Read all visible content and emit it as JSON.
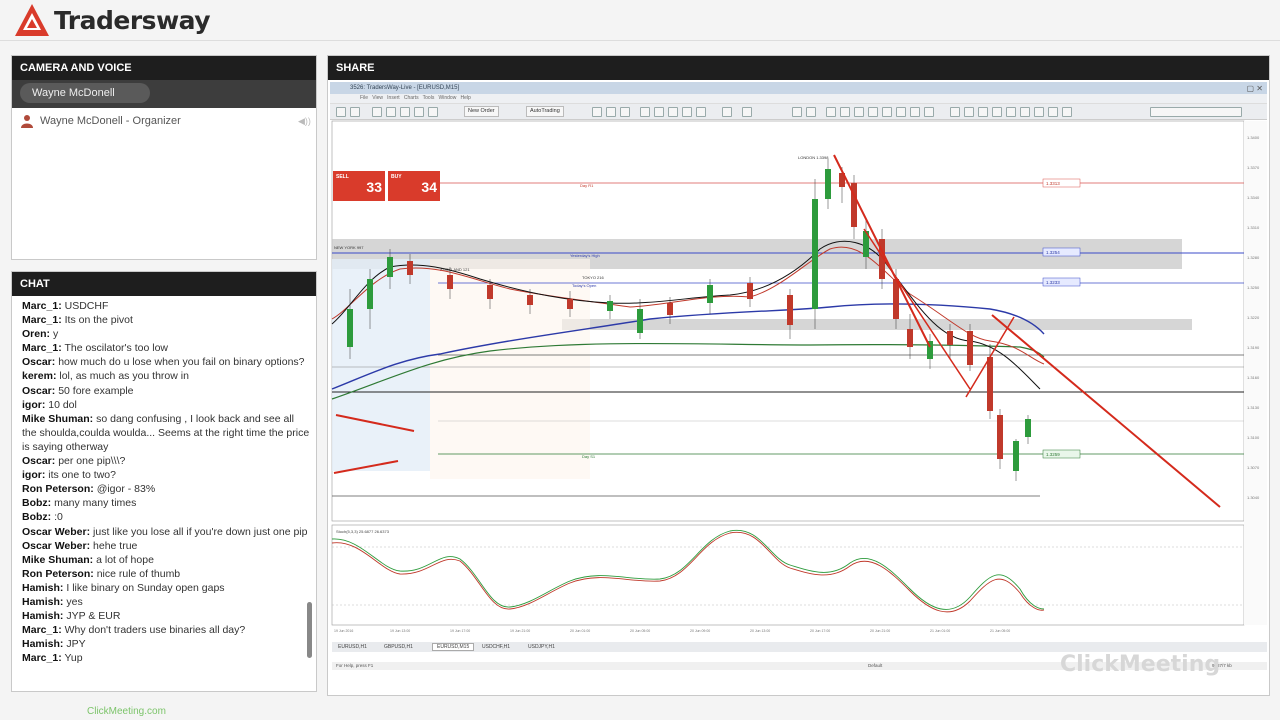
{
  "brand": {
    "name": "Tradersway",
    "accent": "#d93b2b"
  },
  "camera_panel": {
    "title": "CAMERA AND VOICE",
    "speaker": "Wayne McDonell",
    "participants": [
      {
        "name": "Wayne McDonell - Organizer",
        "icon": "user-icon"
      }
    ]
  },
  "chat_panel": {
    "title": "CHAT",
    "messages": [
      {
        "user": "Marc_1:",
        "text": "USDCHF"
      },
      {
        "user": "Marc_1:",
        "text": "Its on the pivot"
      },
      {
        "user": "Oren:",
        "text": "y"
      },
      {
        "user": "Marc_1:",
        "text": "The oscilator's too low"
      },
      {
        "user": "Oscar:",
        "text": "how much do u lose when you fail on binary options?"
      },
      {
        "user": "kerem:",
        "text": "lol, as much as you throw in"
      },
      {
        "user": "Oscar:",
        "text": "50 fore example"
      },
      {
        "user": "igor:",
        "text": "10 dol"
      },
      {
        "user": "Mike Shuman:",
        "text": "so dang confusing , I look back and see all the shoulda,coulda woulda... Seems at the right time the price is saying otherway"
      },
      {
        "user": "Oscar:",
        "text": "per one pip\\\\\\?"
      },
      {
        "user": "igor:",
        "text": "its one to two?"
      },
      {
        "user": "Ron Peterson:",
        "text": "@igor - 83%"
      },
      {
        "user": "Bobz:",
        "text": "many many times"
      },
      {
        "user": "Bobz:",
        "text": ":0"
      },
      {
        "user": "Oscar Weber:",
        "text": "just like you lose all if you're down just one pip"
      },
      {
        "user": "Oscar Weber:",
        "text": "hehe   true"
      },
      {
        "user": "Mike Shuman:",
        "text": "a lot of hope"
      },
      {
        "user": "Ron Peterson:",
        "text": "nice rule of thumb"
      },
      {
        "user": "Hamish:",
        "text": "I like binary on Sunday open gaps"
      },
      {
        "user": "Hamish:",
        "text": "yes"
      },
      {
        "user": "Hamish:",
        "text": "JYP & EUR"
      },
      {
        "user": "Marc_1:",
        "text": "Why don't traders use binaries all day?"
      },
      {
        "user": "Hamish:",
        "text": "JPY"
      },
      {
        "user": "Marc_1:",
        "text": "Yup"
      }
    ]
  },
  "footer_link": "ClickMeeting.com",
  "share_panel": {
    "title": "SHARE",
    "watermark": "ClickMeeting",
    "mt4": {
      "title_bar": "3526: TradersWay-Live - [EURUSD,M15]",
      "menu": [
        "File",
        "View",
        "Insert",
        "Charts",
        "Tools",
        "Window",
        "Help"
      ],
      "new_order": "New Order",
      "autotrading": "AutoTrading",
      "one_click": {
        "sell_label": "SELL",
        "buy_label": "BUY",
        "sell_price": "33",
        "buy_price": "34",
        "lot": "1.00"
      },
      "chart_labels": {
        "london": "LONDON 1.3398",
        "new_york": "NEW YORK 997",
        "auckland": "AUCKLAND 121",
        "tokyo": "TOKYO 216",
        "day_r1": "Day R1",
        "yesterday_high": "Yesterday's High",
        "todays_open": "Today's Open",
        "day_s1": "Day S1",
        "price_1": "1.3313",
        "price_2": "1.3254",
        "price_3": "1.3233",
        "price_4": "1.3259"
      },
      "oscillator_label": "Stoch(5,3,3) 25.6877 26.6373",
      "tabs": [
        "EURUSD,H1",
        "GBPUSD,H1",
        "EURUSD,M15",
        "USDCHF,H1",
        "USDJPY,H1"
      ],
      "status_left": "For Help, press F1",
      "status_mid": "Default",
      "status_right": "9887/7 kb"
    },
    "colors": {
      "up": "#2d9b3c",
      "down": "#c0392b",
      "trend": "#d42a1c",
      "zone": "#c8c8c8",
      "blue_ma": "#2c3aa8",
      "green_ma": "#2f7a35"
    }
  }
}
